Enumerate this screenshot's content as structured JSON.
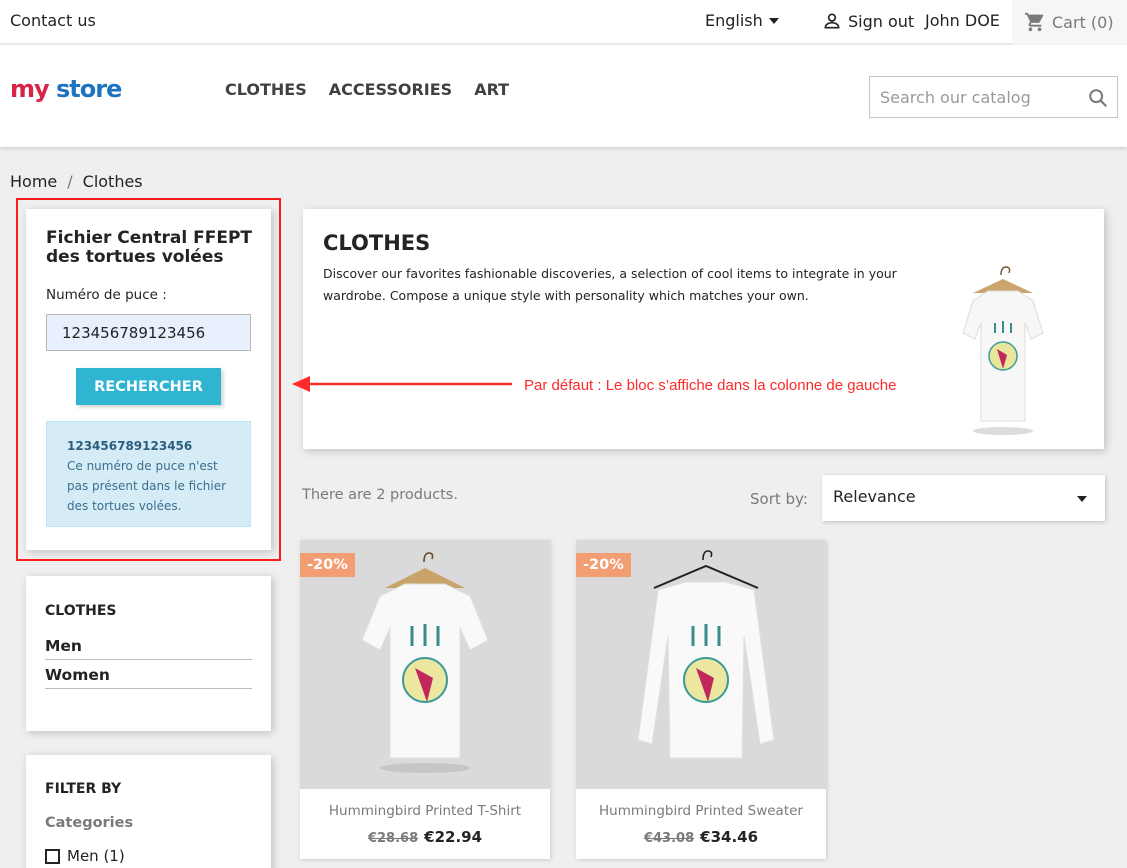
{
  "topbar": {
    "contact": "Contact us",
    "language": "English",
    "sign_out": "Sign out",
    "user": "John DOE",
    "cart": "Cart (0)"
  },
  "header": {
    "logo": {
      "part1": "my",
      "part2": "store"
    },
    "nav": [
      "CLOTHES",
      "ACCESSORIES",
      "ART"
    ],
    "search_placeholder": "Search our catalog"
  },
  "breadcrumb": [
    "Home",
    "/",
    "Clothes"
  ],
  "turtle_block": {
    "title": "Fichier Central FFEPT des tortues volées",
    "label": "Numéro de puce :",
    "input_value": "123456789123456",
    "button": "RECHERCHER",
    "alert_number": "123456789123456",
    "alert_text": "Ce numéro de puce n'est pas présent dans le fichier des tortues volées."
  },
  "categories": {
    "title": "CLOTHES",
    "items": [
      "Men",
      "Women"
    ]
  },
  "filters": {
    "title": "FILTER BY",
    "subtitle": "Categories",
    "items": [
      "Men (1)"
    ]
  },
  "hero": {
    "title": "CLOTHES",
    "description": "Discover our favorites fashionable discoveries, a selection of cool items to integrate in your wardrobe. Compose a unique style with personality which matches your own."
  },
  "annotation": "Par défaut : Le bloc s’affiche dans la colonne de gauche",
  "listing": {
    "count": "There are 2 products.",
    "sort_label": "Sort by:",
    "sort_value": "Relevance"
  },
  "products": [
    {
      "name": "Hummingbird Printed T-Shirt",
      "badge": "-20%",
      "old_price": "€28.68",
      "price": "€22.94"
    },
    {
      "name": "Hummingbird Printed Sweater",
      "badge": "-20%",
      "old_price": "€43.08",
      "price": "€34.46"
    }
  ],
  "colors": {
    "accent": "#2fb5d2",
    "badge": "#f39d72",
    "annotation": "#ff2a2a"
  }
}
